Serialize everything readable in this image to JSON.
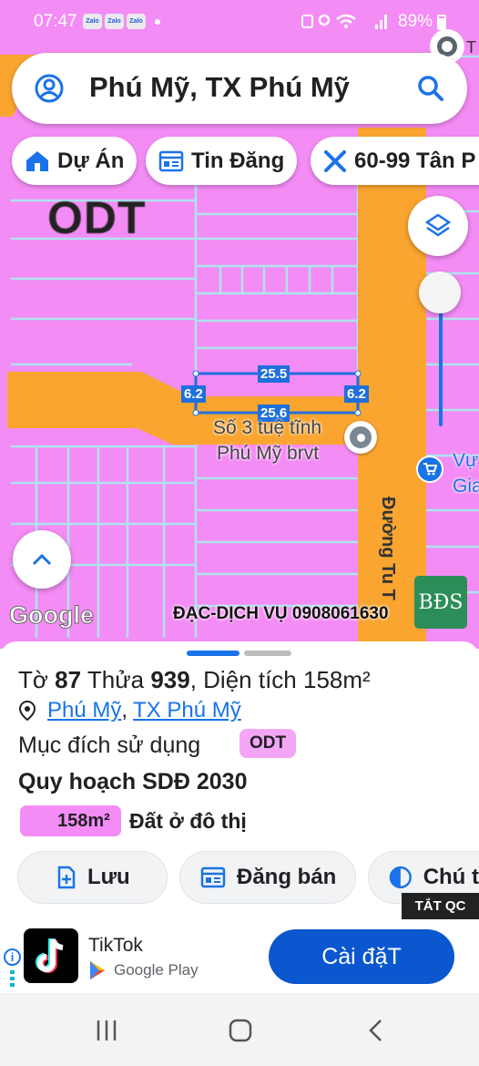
{
  "status_bar": {
    "time": "07:47",
    "notification_apps": [
      "Zalo",
      "Zalo",
      "Zalo"
    ],
    "battery": "89%"
  },
  "search": {
    "title": "Phú Mỹ, TX Phú Mỹ"
  },
  "chips": [
    {
      "label": "Dự Án",
      "icon": "house-icon"
    },
    {
      "label": "Tin Đăng",
      "icon": "newspaper-icon"
    },
    {
      "label": "60-99 Tân P",
      "icon": "ruler-cross-icon"
    }
  ],
  "map": {
    "zone_label": "ODT",
    "dimensions": {
      "top": "25.5",
      "bottom": "25.6",
      "left": "6.2",
      "right": "6.2"
    },
    "place_name_1": "Số 3 tuệ tĩnh",
    "place_name_2": "Phú Mỹ brvt",
    "street_label": "Đường Tu T",
    "shop_label_1": "Vự",
    "shop_label_2": "Gia",
    "corner_label": "T",
    "google": "Google",
    "ad_text": "ĐẠC-DỊCH VỤ 0908061630",
    "bds_logo": "BĐS",
    "colors": {
      "residential": "#f48cf5",
      "road": "#f9a530",
      "grid": "#aee3ee"
    }
  },
  "sheet": {
    "sheet_label": "Tờ",
    "sheet_no": "87",
    "plot_label": "Thửa",
    "plot_no": "939",
    "area_label": "Diện tích",
    "area": "158m²",
    "ward": "Phú Mỹ",
    "separator": ",",
    "town": "TX Phú Mỹ",
    "purpose_label": "Mục đích sử dụng",
    "purpose_code": "ODT",
    "plan_title": "Quy hoạch SDĐ 2030",
    "legend_area": "158m²",
    "legend_text": "Đất ở đô thị",
    "buttons": [
      "Lưu",
      "Đăng bán",
      "Chú t"
    ]
  },
  "ad": {
    "close_label": "TẮT QC",
    "info": "i",
    "app_name": "TikTok",
    "store": "Google Play",
    "install_label": "Cài đặT"
  }
}
